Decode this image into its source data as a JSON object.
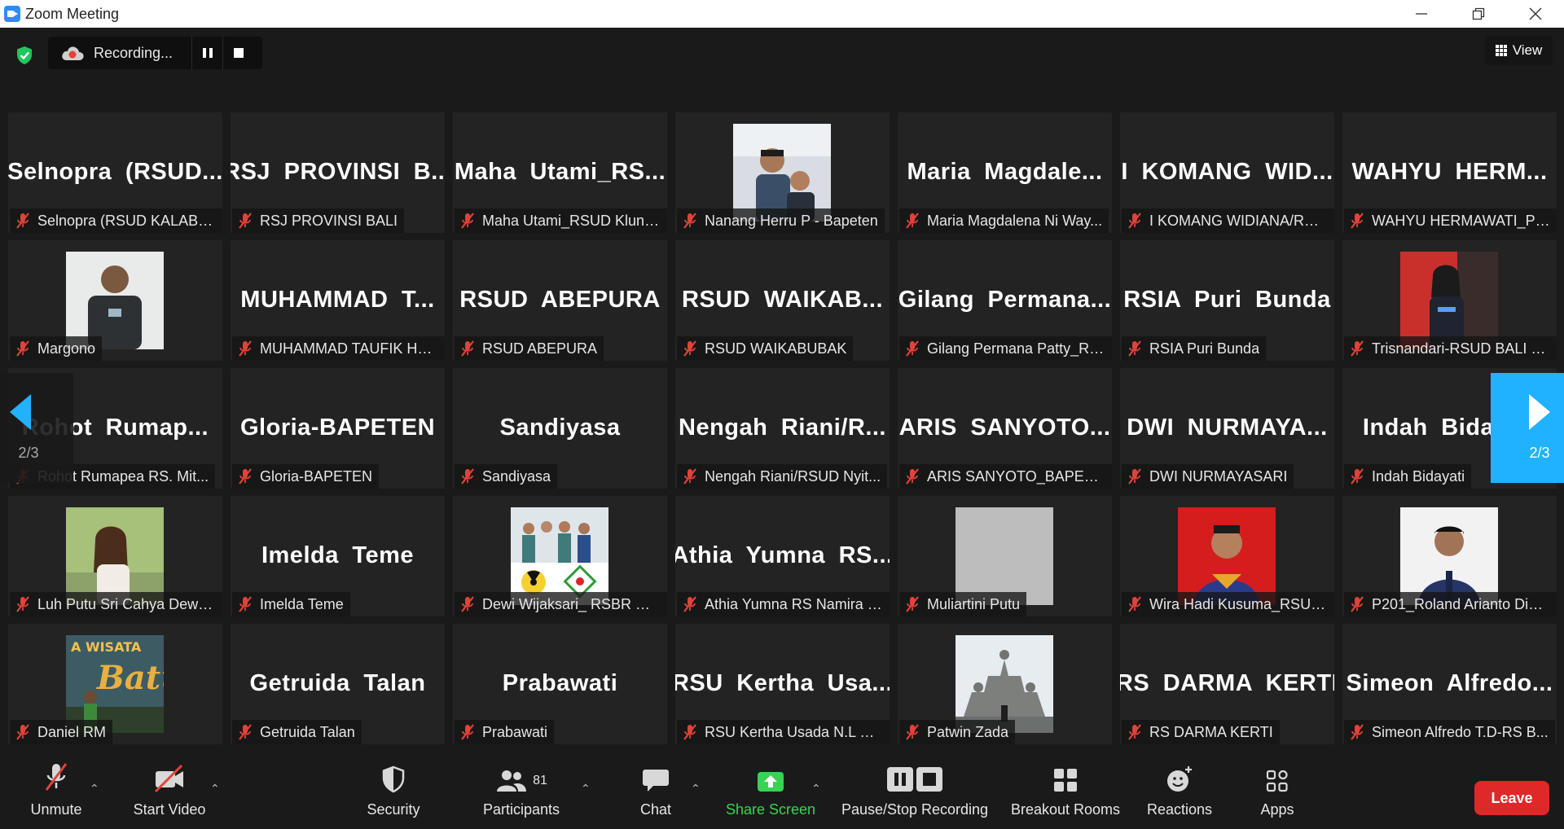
{
  "window": {
    "title": "Zoom Meeting"
  },
  "recording": {
    "status": "Recording..."
  },
  "view": {
    "label": "View"
  },
  "pagination": {
    "left": "2/3",
    "right": "2/3"
  },
  "tiles": [
    {
      "big": "Selnopra  (RSUD...",
      "label": "Selnopra (RSUD KALABA..."
    },
    {
      "big": "RSJ  PROVINSI  B...",
      "label": "RSJ PROVINSI BALI"
    },
    {
      "big": "Maha  Utami_RS...",
      "label": "Maha Utami_RSUD Klung..."
    },
    {
      "photo": "person-with-child",
      "label": "Nanang Herru P - Bapeten"
    },
    {
      "big": "Maria  Magdale...",
      "label": "Maria Magdalena Ni Way..."
    },
    {
      "big": "I  KOMANG  WID...",
      "label": "I KOMANG WIDIANA/RSU..."
    },
    {
      "big": "WAHYU  HERM...",
      "label": "WAHYU HERMAWATI_PR..."
    },
    {
      "photo": "man-uniform",
      "label": "Margono"
    },
    {
      "big": "MUHAMMAD  T...",
      "label": "MUHAMMAD TAUFIK HA..."
    },
    {
      "big": "RSUD  ABEPURA",
      "label": "RSUD ABEPURA"
    },
    {
      "big": "RSUD  WAIKAB...",
      "label": "RSUD WAIKABUBAK"
    },
    {
      "big": "Gilang  Permana...",
      "label": "Gilang Permana Patty_RS..."
    },
    {
      "big": "RSIA  Puri  Bunda",
      "label": "RSIA Puri Bunda"
    },
    {
      "photo": "woman-red-wall",
      "label": "Trisnandari-RSUD BALI M..."
    },
    {
      "big": "Rohot  Rumap...",
      "label": "Rohot Rumapea RS. Mit..."
    },
    {
      "big": "Gloria-BAPETEN",
      "label": "Gloria-BAPETEN"
    },
    {
      "big": "Sandiyasa",
      "label": "Sandiyasa"
    },
    {
      "big": "Nengah  Riani/R...",
      "label": "Nengah Riani/RSUD  Nyit..."
    },
    {
      "big": "ARIS  SANYOTO...",
      "label": "ARIS SANYOTO_BAPETEN"
    },
    {
      "big": "DWI  NURMAYA...",
      "label": "DWI NURMAYASARI"
    },
    {
      "big": "Indah  Bidayati",
      "label": "Indah Bidayati"
    },
    {
      "photo": "woman-garden",
      "label": "Luh Putu Sri Cahya Dewi-..."
    },
    {
      "big": "Imelda  Teme",
      "label": "Imelda Teme"
    },
    {
      "photo": "group-radiation",
      "label": "Dewi Wijaksari_ RSBR DPS"
    },
    {
      "big": "Athia  Yumna  RS...",
      "label": "Athia Yumna RS Namira L..."
    },
    {
      "photo": "gray-placeholder",
      "label": "Muliartini Putu"
    },
    {
      "photo": "man-red-bg",
      "label": "Wira Hadi Kusuma_RSUD..."
    },
    {
      "photo": "man-white-bg",
      "label": "P201_Roland Arianto Dim..."
    },
    {
      "photo": "batu-sign",
      "label": "Daniel RM"
    },
    {
      "big": "Getruida  Talan",
      "label": "Getruida Talan"
    },
    {
      "big": "Prabawati",
      "label": "Prabawati"
    },
    {
      "big": "RSU  Kertha  Usa...",
      "label": "RSU Kertha Usada N.L Vit..."
    },
    {
      "photo": "temple",
      "label": "Patwin Zada"
    },
    {
      "big": "RS  DARMA  KERTI",
      "label": "RS DARMA KERTI"
    },
    {
      "big": "Simeon  Alfredo...",
      "label": "Simeon Alfredo T.D-RS B..."
    }
  ],
  "toolbar": {
    "unmute": "Unmute",
    "start_video": "Start Video",
    "security": "Security",
    "participants": "Participants",
    "participants_count": "81",
    "chat": "Chat",
    "share_screen": "Share Screen",
    "pause_stop": "Pause/Stop Recording",
    "breakout": "Breakout Rooms",
    "reactions": "Reactions",
    "apps": "Apps",
    "leave": "Leave"
  },
  "colors": {
    "accent": "#21b2ff",
    "share": "#39d353",
    "leave": "#e02828",
    "mute": "#e0433a"
  }
}
